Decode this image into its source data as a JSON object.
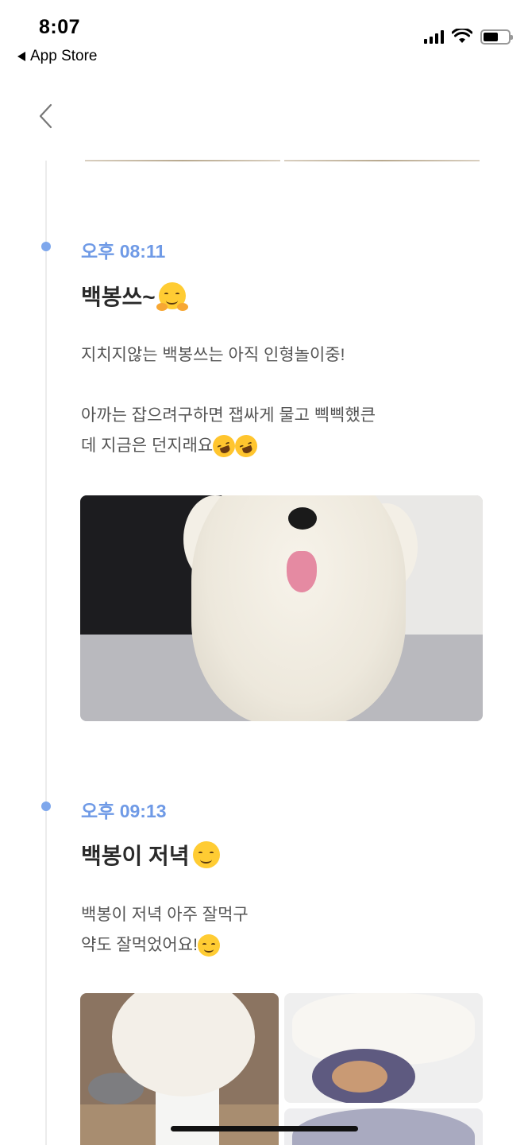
{
  "status_bar": {
    "time": "8:07",
    "back_app_label": "App Store",
    "icons": [
      "signal-icon",
      "wifi-icon",
      "battery-icon"
    ]
  },
  "nav": {
    "back_icon": "chevron-left-icon"
  },
  "colors": {
    "accent": "#6f9ae6",
    "dot": "#7ea7ec",
    "timeline": "#ececec"
  },
  "posts": [
    {
      "time": "오후 08:11",
      "title": "백봉쓰~",
      "title_emoji": "hugging-face-emoji",
      "body_lines": [
        "지치지않는 백봉쓰는 아직 인형놀이중!",
        "아까는 잡으려구하면 잽싸게 물고 삑삑했큰",
        "데 지금은 던지래요"
      ],
      "body_emoji": [
        "rolling-laughing-emoji",
        "rolling-laughing-emoji"
      ]
    },
    {
      "time": "오후 09:13",
      "title": "백봉이 저녁",
      "title_emoji": "smiling-face-emoji",
      "body_lines": [
        "백봉이 저녁 아주 잘먹구",
        "약도 잘먹었어요!"
      ],
      "body_emoji": [
        "smiling-face-emoji"
      ]
    }
  ]
}
